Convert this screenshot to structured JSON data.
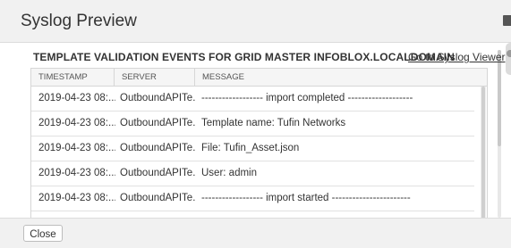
{
  "dialog": {
    "title": "Syslog Preview",
    "section_title": "TEMPLATE VALIDATION EVENTS FOR GRID MASTER INFOBLOX.LOCALDOMAIN",
    "syslog_link": "Go to Syslog Viewer"
  },
  "table": {
    "columns": [
      "TIMESTAMP",
      "SERVER",
      "MESSAGE"
    ],
    "rows": [
      [
        "2019-04-23 08:...",
        "OutboundAPITe...",
        "------------------ import completed -------------------"
      ],
      [
        "2019-04-23 08:...",
        "OutboundAPITe...",
        "Template name: Tufin Networks"
      ],
      [
        "2019-04-23 08:...",
        "OutboundAPITe...",
        "File: Tufin_Asset.json"
      ],
      [
        "2019-04-23 08:...",
        "OutboundAPITe...",
        "User: admin"
      ],
      [
        "2019-04-23 08:...",
        "OutboundAPITe...",
        "------------------ import started -----------------------"
      ]
    ]
  },
  "footer": {
    "close_label": "Close"
  }
}
